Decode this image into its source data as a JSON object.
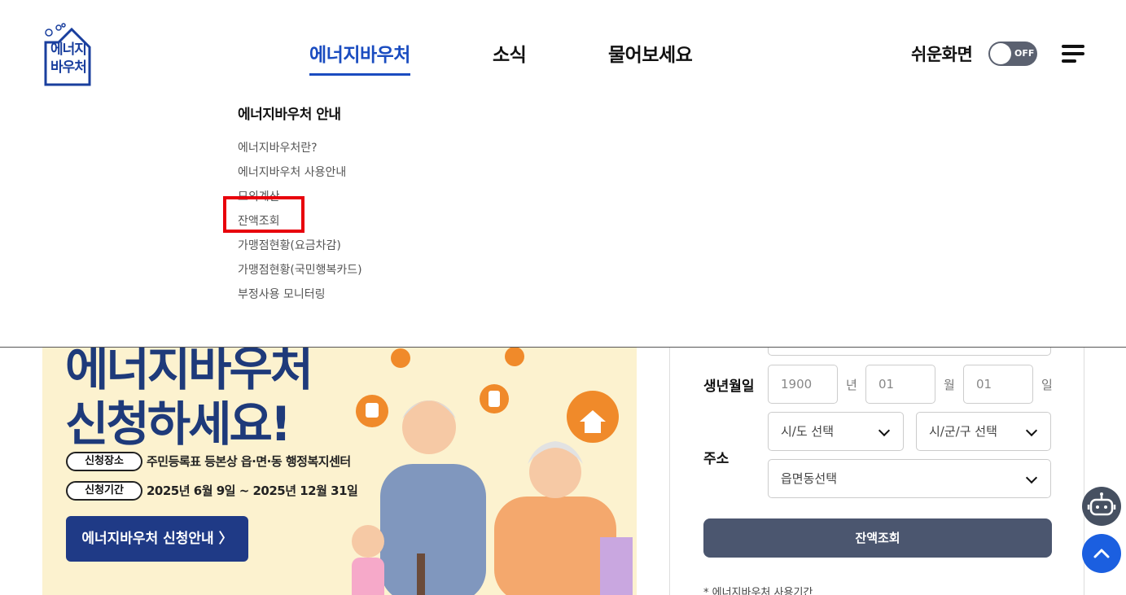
{
  "logo": {
    "line1": "에너지",
    "line2": "바우처"
  },
  "nav": {
    "items": [
      {
        "label": "에너지바우처",
        "active": true
      },
      {
        "label": "소식",
        "active": false
      },
      {
        "label": "물어보세요",
        "active": false
      }
    ]
  },
  "utility": {
    "easy_view_label": "쉬운화면",
    "toggle_state": "OFF",
    "menu_icon": "hamburger-icon"
  },
  "submenu": {
    "title": "에너지바우처 안내",
    "items": [
      "에너지바우처란?",
      "에너지바우처 사용안내",
      "모의계산",
      "잔액조회",
      "가맹점현황(요금차감)",
      "가맹점현황(국민행복카드)",
      "부정사용 모니터링"
    ],
    "highlighted": "잔액조회"
  },
  "banner": {
    "headline1": "에너지바우처",
    "headline2": "신청하세요!",
    "rows": [
      {
        "tag": "신청장소",
        "text": "주민등록표 등본상 읍·면·동 행정복지센터"
      },
      {
        "tag": "신청기간",
        "text": "2025년 6월 9일 ~ 2025년 12월 31일"
      }
    ],
    "button": "에너지바우처 신청안내 〉"
  },
  "form": {
    "birth_label": "생년월일",
    "year": {
      "placeholder": "1900",
      "unit": "년"
    },
    "month": {
      "placeholder": "01",
      "unit": "월"
    },
    "day": {
      "placeholder": "01",
      "unit": "일"
    },
    "address_label": "주소",
    "sido": "시/도 선택",
    "sigungu": "시/군/구 선택",
    "emd": "읍면동선택",
    "submit": "잔액조회",
    "note": "* 에너지바우처 사용기간"
  },
  "colors": {
    "accent": "#1a4cc0",
    "navy": "#1e3a7a",
    "submit_bg": "#4b566f",
    "highlight": "#e8000b",
    "banner_bg": "#fcf2cf"
  }
}
